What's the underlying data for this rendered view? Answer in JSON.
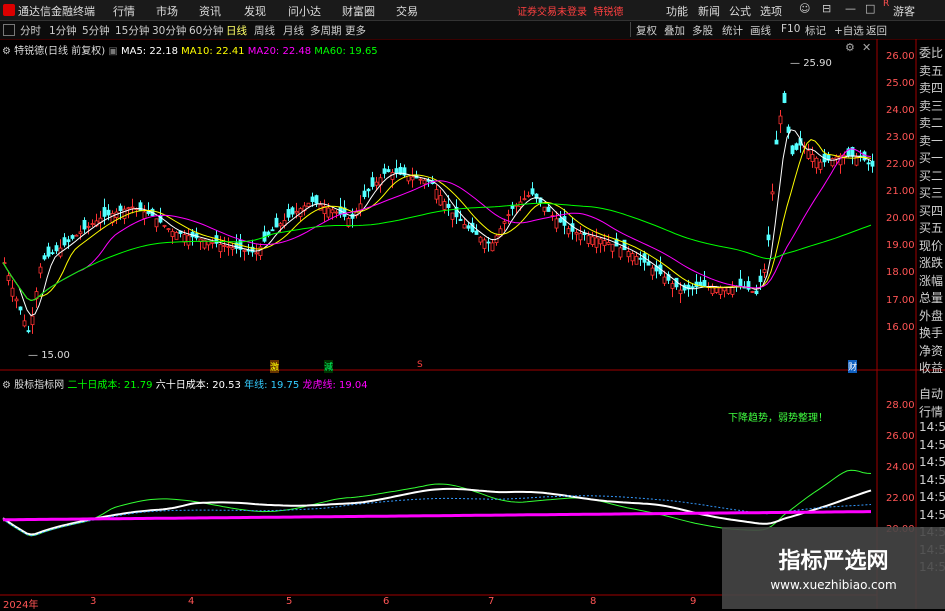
{
  "app": {
    "title": "通达信金融终端"
  },
  "menu": [
    "行情",
    "市场",
    "资讯",
    "发现",
    "问小达",
    "财富圈",
    "交易"
  ],
  "notice": "证券交易未登录",
  "stock_name_top": "特锐德",
  "right_menu": [
    "功能",
    "新闻",
    "公式",
    "选项"
  ],
  "guest": "游客",
  "periods": [
    "分时",
    "1分钟",
    "5分钟",
    "15分钟",
    "30分钟",
    "60分钟",
    "日线",
    "周线",
    "月线",
    "多周期",
    "更多"
  ],
  "active_period": "日线",
  "tools": [
    "复权",
    "叠加",
    "多股",
    "统计",
    "画线",
    "F10",
    "标记",
    "+自选",
    "返回"
  ],
  "main_legend": {
    "name": "特锐德(日线 前复权)",
    "ma5": "MA5: 22.18",
    "ma10": "MA10: 22.41",
    "ma20": "MA20: 22.48",
    "ma60": "MA60: 19.65",
    "colors": {
      "ma5": "#ffffff",
      "ma10": "#ffff00",
      "ma20": "#ff00ff",
      "ma60": "#00ff00"
    }
  },
  "sub_legend": {
    "name": "股标指标网",
    "cost20": "二十日成本: 21.79",
    "cost60": "六十日成本: 20.53",
    "yearline": "年线: 19.75",
    "dragon": "龙虎线: 19.04"
  },
  "main_axis": [
    "26.00",
    "25.00",
    "24.00",
    "23.00",
    "22.00",
    "21.00",
    "20.00",
    "19.00",
    "18.00",
    "17.00",
    "16.00"
  ],
  "sub_axis": [
    "28.00",
    "26.00",
    "24.00",
    "22.00",
    "20.00"
  ],
  "annotations": {
    "high": "25.90",
    "low": "15.00"
  },
  "event_markers": [
    "激",
    "減",
    "S",
    "财"
  ],
  "sub_text": "下降趋势，弱势整理！",
  "date_axis": [
    "2024年",
    "3",
    "4",
    "5",
    "6",
    "7",
    "8",
    "9"
  ],
  "side_panel": [
    "委比",
    "卖五",
    "卖四",
    "卖三",
    "卖二",
    "卖一",
    "买一",
    "买二",
    "买三",
    "买四",
    "买五",
    "现价",
    "涨跌",
    "涨幅",
    "总量",
    "外盘",
    "换手",
    "净资",
    "收益"
  ],
  "side_panel_lower": [
    "自动",
    "行情",
    "14:5",
    "14:5",
    "14:5",
    "14:5",
    "14:5",
    "14:5",
    "14:5",
    "14:5",
    "14:5"
  ],
  "watermark": {
    "title": "指标严选网",
    "url": "www.xuezhibiao.com"
  }
}
